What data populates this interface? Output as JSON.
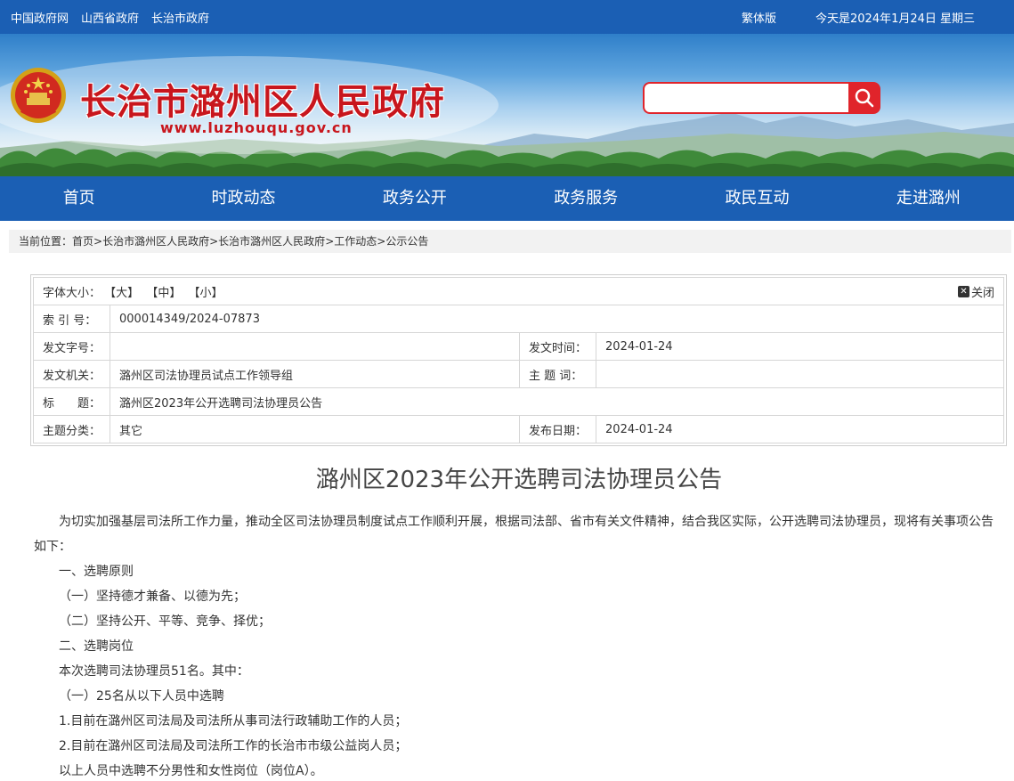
{
  "top": {
    "links": [
      "中国政府网",
      "山西省政府",
      "长治市政府"
    ],
    "traditional": "繁体版",
    "date": "今天是2024年1月24日 星期三"
  },
  "header": {
    "title": "长治市潞州区人民政府",
    "url": "www.luzhouqu.gov.cn",
    "search_placeholder": "",
    "colors": {
      "brand_blue": "#1b5fb4",
      "title_red": "#c8161d",
      "search_red": "#e0242b"
    }
  },
  "nav": [
    "首页",
    "时政动态",
    "政务公开",
    "政务服务",
    "政民互动",
    "走进潞州"
  ],
  "breadcrumb": {
    "label": "当前位置：",
    "items": [
      "首页",
      "长治市潞州区人民政府",
      "长治市潞州区人民政府",
      "工作动态",
      "公示公告"
    ],
    "sep": ">"
  },
  "info": {
    "font_label": "字体大小：",
    "font_sizes": [
      "【大】",
      "【中】",
      "【小】"
    ],
    "close": "关闭",
    "index_label": "索 引 号：",
    "index_value": "000014349/2024-07873",
    "docno_label": "发文字号：",
    "docno_value": "",
    "date_label": "发文时间：",
    "date_value": "2024-01-24",
    "org_label": "发文机关：",
    "org_value": "潞州区司法协理员试点工作领导组",
    "keyword_label": "主 题 词：",
    "keyword_value": "",
    "title_label": "标　　题：",
    "title_value": "潞州区2023年公开选聘司法协理员公告",
    "cat_label": "主题分类：",
    "cat_value": "其它",
    "pub_label": "发布日期：",
    "pub_value": "2024-01-24"
  },
  "article": {
    "title": "潞州区2023年公开选聘司法协理员公告",
    "paragraphs": [
      "为切实加强基层司法所工作力量，推动全区司法协理员制度试点工作顺利开展，根据司法部、省市有关文件精神，结合我区实际，公开选聘司法协理员，现将有关事项公告如下：",
      "一、选聘原则",
      "（一）坚持德才兼备、以德为先；",
      "（二）坚持公开、平等、竞争、择优；",
      "二、选聘岗位",
      "本次选聘司法协理员51名。其中：",
      "（一）25名从以下人员中选聘",
      "1.目前在潞州区司法局及司法所从事司法行政辅助工作的人员；",
      "2.目前在潞州区司法局及司法所工作的长治市市级公益岗人员；",
      "以上人员中选聘不分男性和女性岗位（岗位A）。"
    ]
  }
}
